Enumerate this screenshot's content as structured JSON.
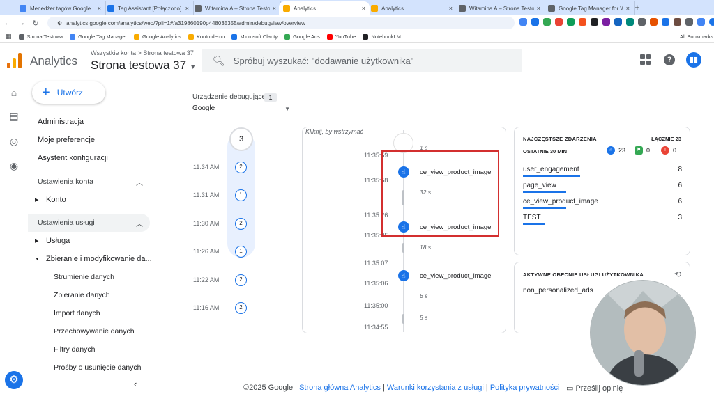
{
  "browser": {
    "tabs": [
      {
        "title": "Menedżer tagów Google",
        "color": "#4285f4"
      },
      {
        "title": "Tag Assistant [Połączono]",
        "color": "#1a73e8"
      },
      {
        "title": "Witamina A – Strona Testowa",
        "color": "#5f6368"
      },
      {
        "title": "Analytics",
        "color": "#f9ab00"
      },
      {
        "title": "Analytics",
        "color": "#f9ab00"
      },
      {
        "title": "Witamina A – Strona Testowa",
        "color": "#5f6368"
      },
      {
        "title": "Google Tag Manager for Word",
        "color": "#5f6368"
      }
    ],
    "new_tab": "+",
    "url": "analytics.google.com/analytics/web/?pli=1#/a319860190p448035355/admin/debugview/overview",
    "bookmarks": [
      {
        "label": "Strona Testowa",
        "color": "#5f6368"
      },
      {
        "label": "Google Tag Manager",
        "color": "#4285f4"
      },
      {
        "label": "Google Analytics",
        "color": "#f9ab00"
      },
      {
        "label": "Konto demo",
        "color": "#f9ab00"
      },
      {
        "label": "Microsoft Clarity",
        "color": "#1a73e8"
      },
      {
        "label": "Google Ads",
        "color": "#34a853"
      },
      {
        "label": "YouTube",
        "color": "#ff0000"
      },
      {
        "label": "NotebookLM",
        "color": "#202124"
      }
    ],
    "all_bookmarks": "All Bookmarks"
  },
  "header": {
    "app_title": "Analytics",
    "breadcrumb": "Wszystkie konta > Strona testowa 37",
    "property": "Strona testowa 37",
    "search_placeholder": "Spróbuj wyszukać: \"dodawanie użytkownika\"",
    "help": "?"
  },
  "sidenav": {
    "create_label": "Utwórz",
    "items": [
      "Administracja",
      "Moje preferencje",
      "Asystent konfiguracji"
    ],
    "section_account": "Ustawienia konta",
    "account_item": "Konto",
    "section_service": "Ustawienia usługi",
    "service_item": "Usługa",
    "collection_item": "Zbieranie i modyfikowanie da...",
    "sub_items": [
      "Strumienie danych",
      "Zbieranie danych",
      "Import danych",
      "Przechowywanie danych",
      "Filtry danych",
      "Prośby o usunięcie danych"
    ]
  },
  "debug": {
    "device_label": "Urządzenie debugujące",
    "device_count": "1",
    "device_value": "Google",
    "minutes_top": "3",
    "minutes": [
      {
        "time": "11:34 AM",
        "count": "2"
      },
      {
        "time": "11:31 AM",
        "count": "1"
      },
      {
        "time": "11:30 AM",
        "count": "2"
      },
      {
        "time": "11:26 AM",
        "count": "1"
      },
      {
        "time": "11:22 AM",
        "count": "2"
      },
      {
        "time": "11:16 AM",
        "count": "2"
      }
    ]
  },
  "stream": {
    "pause_hint": "Kliknij, by wstrzymać",
    "times": [
      "11:35:59",
      "11:35:58",
      "11:35:26",
      "11:35:25",
      "11:35:07",
      "11:35:06",
      "11:35:00",
      "11:34:55"
    ],
    "durations": [
      "1 s",
      "32 s",
      "18 s",
      "6 s",
      "5 s"
    ],
    "events": [
      "ce_view_product_image",
      "ce_view_product_image",
      "ce_view_product_image"
    ]
  },
  "top_events": {
    "title": "NAJCZĘSTSZE ZDARZENIA",
    "total": "ŁĄCZNIE 23",
    "subtitle": "OSTATNIE 30 MIN",
    "counts": [
      "23",
      "0",
      "0"
    ],
    "rows": [
      {
        "name": "user_engagement",
        "value": "8"
      },
      {
        "name": "page_view",
        "value": "6"
      },
      {
        "name": "ce_view_product_image",
        "value": "6"
      },
      {
        "name": "TEST",
        "value": "3"
      }
    ]
  },
  "active_users": {
    "title": "AKTYWNE OBECNIE USŁUGI UŻYTKOWNIKA",
    "item": "non_personalized_ads"
  },
  "footer": {
    "copyright": "©2025 Google | ",
    "links": [
      "Strona główna Analytics",
      "Warunki korzystania z usługi",
      "Polityka prywatności"
    ],
    "sep": " | ",
    "feedback": "Prześlij opinię"
  },
  "colors": {
    "accent": "#1a73e8",
    "highlight_box": "#d32f2f",
    "logo": [
      "#f9ab00",
      "#e37400",
      "#e8710a"
    ]
  }
}
